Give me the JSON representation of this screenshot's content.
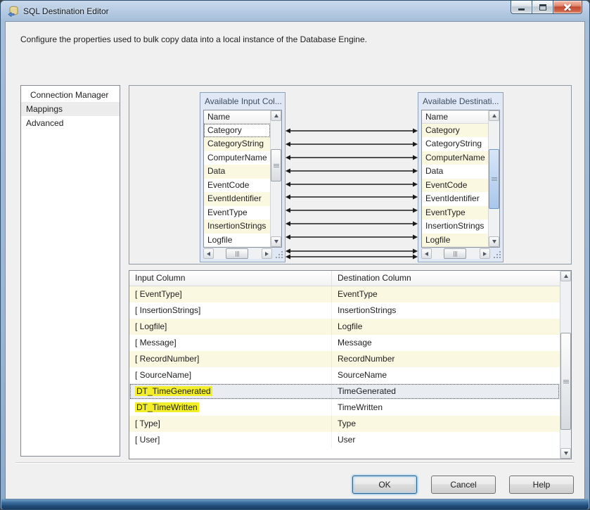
{
  "window": {
    "title": "SQL Destination Editor"
  },
  "titlebar": {
    "icons": [
      "sql-destination-icon"
    ],
    "buttons": [
      "minimize",
      "maximize",
      "close"
    ]
  },
  "description": "Configure the properties used to bulk copy data into a local instance of the Database Engine.",
  "sidebar": {
    "items": [
      {
        "label": "Connection Manager",
        "selected": false
      },
      {
        "label": "Mappings",
        "selected": true
      },
      {
        "label": "Advanced",
        "selected": false
      }
    ]
  },
  "mapping": {
    "input_box": {
      "title": "Available Input Col...",
      "column_header": "Name",
      "rows": [
        "Category",
        "CategoryString",
        "ComputerName",
        "Data",
        "EventCode",
        "EventIdentifier",
        "EventType",
        "InsertionStrings",
        "Logfile"
      ],
      "focused_row": "Category"
    },
    "destination_box": {
      "title": "Available Destinati...",
      "column_header": "Name",
      "rows": [
        "Category",
        "CategoryString",
        "ComputerName",
        "Data",
        "EventCode",
        "EventIdentifier",
        "EventType",
        "InsertionStrings",
        "Logfile"
      ]
    },
    "connector_line_ys": [
      64,
      83,
      102,
      121,
      140,
      158,
      177,
      196,
      215,
      235,
      243
    ]
  },
  "table": {
    "headers": [
      "Input Column",
      "Destination Column"
    ],
    "rows": [
      {
        "input": "[ EventType]",
        "destination": "EventType"
      },
      {
        "input": "[ InsertionStrings]",
        "destination": "InsertionStrings"
      },
      {
        "input": "[ Logfile]",
        "destination": "Logfile"
      },
      {
        "input": "[ Message]",
        "destination": "Message"
      },
      {
        "input": "[ RecordNumber]",
        "destination": "RecordNumber"
      },
      {
        "input": "[ SourceName]",
        "destination": "SourceName"
      },
      {
        "input": "DT_TimeGenerated",
        "destination": "TimeGenerated",
        "input_highlighted": true,
        "selected": true
      },
      {
        "input": "DT_TimeWritten",
        "destination": "TimeWritten",
        "input_highlighted": true
      },
      {
        "input": "[ Type]",
        "destination": "Type"
      },
      {
        "input": "[ User]",
        "destination": "User"
      }
    ]
  },
  "buttons": {
    "ok": "OK",
    "cancel": "Cancel",
    "help": "Help"
  },
  "colors": {
    "row_alt_yellow": "#fbf8e1",
    "text_marker_yellow": "#f2ee2b",
    "selected_row": "#e9edf2",
    "box_header_bg": "#dfe8f4",
    "titlebar_blue": "#b2c8e1",
    "frame_bottom_blue": "#1f4b77",
    "close_button_red": "#c24a31",
    "aero_thumb_blue": "#a9c7ea"
  }
}
